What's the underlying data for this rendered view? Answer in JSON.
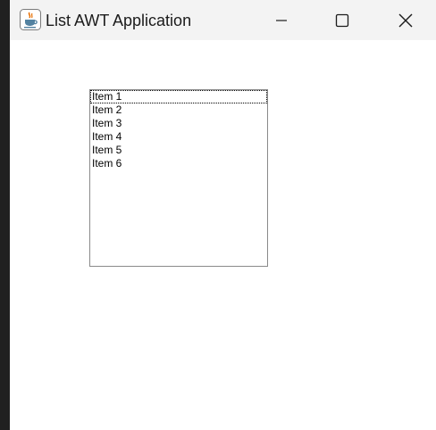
{
  "window": {
    "title": "List AWT Application",
    "app_icon": "java-cup-icon",
    "controls": {
      "minimize_icon": "minimize-icon",
      "maximize_icon": "maximize-icon",
      "close_icon": "close-icon"
    }
  },
  "list": {
    "items": [
      "Item 1",
      "Item 2",
      "Item 3",
      "Item 4",
      "Item 5",
      "Item 6"
    ],
    "focused_index": 0
  },
  "colors": {
    "titlebar_bg": "#f3f3f3",
    "client_bg": "#ffffff",
    "list_border": "#8a8a8a",
    "java_cup_red": "#e76f00",
    "java_cup_blue": "#5382a1"
  }
}
